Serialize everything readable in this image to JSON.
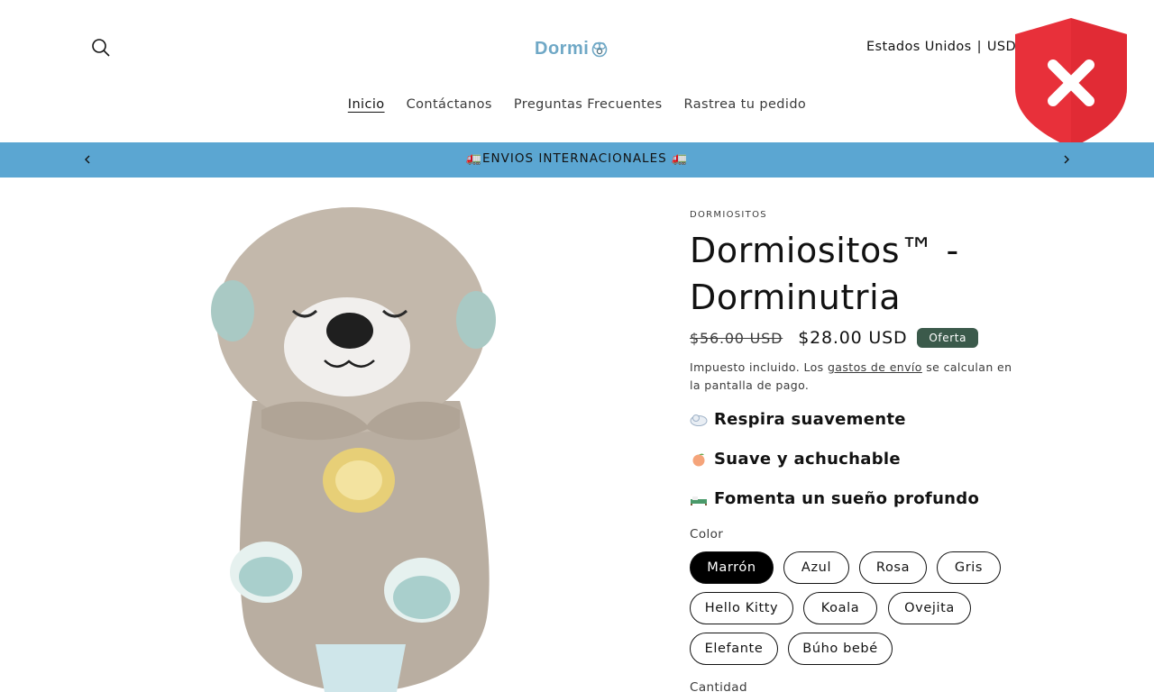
{
  "header": {
    "logo_text": "Dormi",
    "locale": {
      "country": "Estados Unidos",
      "currency": "USD $"
    },
    "nav": [
      {
        "label": "Inicio"
      },
      {
        "label": "Contáctanos"
      },
      {
        "label": "Preguntas Frecuentes"
      },
      {
        "label": "Rastrea tu pedido"
      }
    ]
  },
  "announcement": {
    "text": "🚛ENVIOS INTERNACIONALES 🚛"
  },
  "product": {
    "vendor": "DORMIOSITOS",
    "title": "Dormiositos™ - Dorminutria",
    "price_old": "$56.00 USD",
    "price_new": "$28.00 USD",
    "badge": "Oferta",
    "tax": {
      "prefix": "Impuesto incluido. Los ",
      "link": "gastos de envío",
      "suffix": " se calculan en la pantalla de pago."
    },
    "features": [
      {
        "icon": "cloud-emoji-icon",
        "text": "Respira suavemente"
      },
      {
        "icon": "peach-emoji-icon",
        "text": "Suave y achuchable"
      },
      {
        "icon": "bed-emoji-icon",
        "text": "Fomenta un sueño profundo"
      }
    ],
    "color_label": "Color",
    "colors": [
      {
        "label": "Marrón",
        "selected": true
      },
      {
        "label": "Azul",
        "selected": false
      },
      {
        "label": "Rosa",
        "selected": false
      },
      {
        "label": "Gris",
        "selected": false
      },
      {
        "label": "Hello Kitty",
        "selected": false
      },
      {
        "label": "Koala",
        "selected": false
      },
      {
        "label": "Ovejita",
        "selected": false
      },
      {
        "label": "Elefante",
        "selected": false
      },
      {
        "label": "Búho bebé",
        "selected": false
      }
    ],
    "quantity_label": "Cantidad"
  },
  "colors": {
    "announcement_bg": "#5ba6d2",
    "badge_bg": "#3b5a4b",
    "shield_red": "#e8303a",
    "logo_blue": "#6fa8c6"
  }
}
